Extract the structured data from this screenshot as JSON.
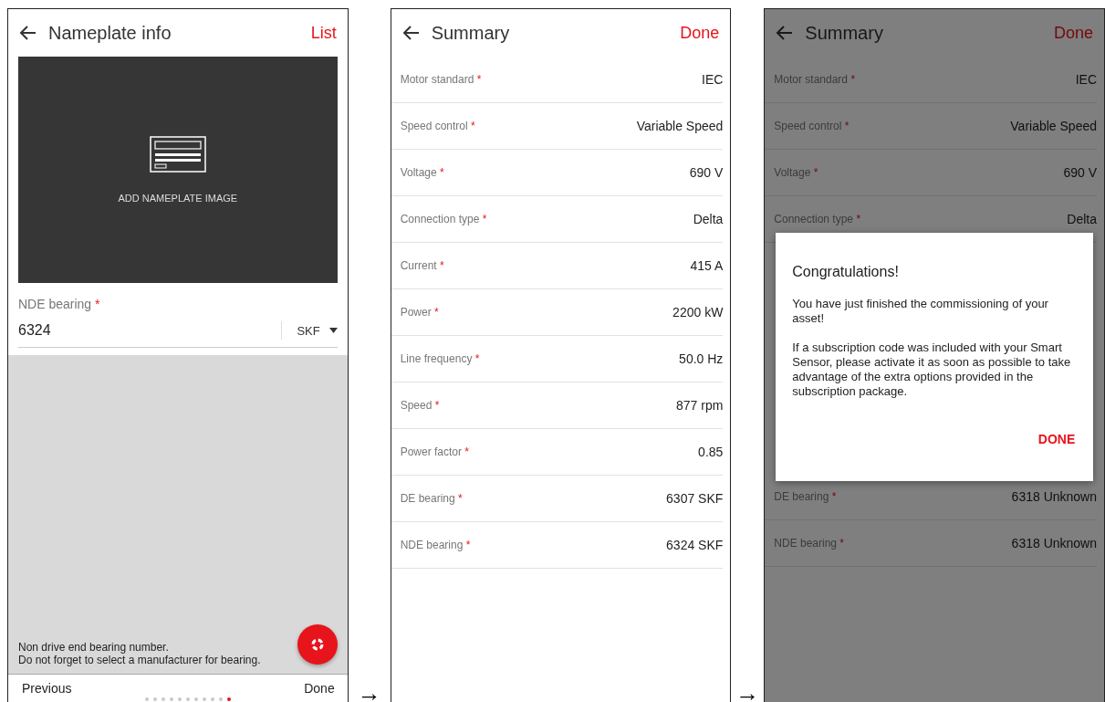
{
  "screens": [
    {
      "kind": "nameplate",
      "title": "Nameplate info",
      "action": "List",
      "image_label": "ADD NAMEPLATE IMAGE",
      "field": {
        "label": "NDE bearing",
        "required_mark": "*",
        "value": "6324",
        "manufacturer": "SKF"
      },
      "hint": [
        "Non drive end bearing number.",
        "Do not forget to select a manufacturer for bearing."
      ],
      "footer": {
        "previous": "Previous",
        "next": "Done",
        "pages": [
          {
            "selected": false
          },
          {
            "selected": false
          },
          {
            "selected": false
          },
          {
            "selected": false
          },
          {
            "selected": false
          },
          {
            "selected": false
          },
          {
            "selected": false
          },
          {
            "selected": false
          },
          {
            "selected": false
          },
          {
            "selected": false
          },
          {
            "selected": true
          }
        ]
      }
    },
    {
      "kind": "arrow",
      "symbol": "→"
    },
    {
      "kind": "summary",
      "title": "Summary",
      "action": "Done",
      "rows": [
        {
          "label": "Motor standard",
          "mark": "*",
          "value": "IEC"
        },
        {
          "label": "Speed control",
          "mark": "*",
          "value": "Variable Speed"
        },
        {
          "label": "Voltage",
          "mark": "*",
          "value": "690 V"
        },
        {
          "label": "Connection type",
          "mark": "*",
          "value": "Delta"
        },
        {
          "label": "Current",
          "mark": "*",
          "value": "415 A"
        },
        {
          "label": "Power",
          "mark": "*",
          "value": "2200 kW"
        },
        {
          "label": "Line frequency",
          "mark": "*",
          "value": "50.0 Hz"
        },
        {
          "label": "Speed",
          "mark": "*",
          "value": "877 rpm"
        },
        {
          "label": "Power factor",
          "mark": "*",
          "value": "0.85"
        },
        {
          "label": "DE bearing",
          "mark": "*",
          "value": "6307 SKF"
        },
        {
          "label": "NDE bearing",
          "mark": "*",
          "value": "6324 SKF"
        }
      ]
    },
    {
      "kind": "arrow",
      "symbol": "→"
    },
    {
      "kind": "summary_dialog",
      "title": "Summary",
      "action": "Done",
      "rows_above": [
        {
          "label": "Motor standard",
          "mark": "*",
          "value": "IEC"
        },
        {
          "label": "Speed control",
          "mark": "*",
          "value": "Variable Speed"
        },
        {
          "label": "Voltage",
          "mark": "*",
          "value": "690 V"
        },
        {
          "label": "Connection type",
          "mark": "*",
          "value": "Delta"
        }
      ],
      "rows_below": [
        {
          "label": "DE bearing",
          "mark": "*",
          "value": "6318 Unknown"
        },
        {
          "label": "NDE bearing",
          "mark": "*",
          "value": "6318 Unknown"
        }
      ],
      "dialog": {
        "title": "Congratulations!",
        "paragraphs": [
          "You have just finished the commissioning of your asset!",
          "If a subscription code was included with your Smart Sensor, please activate it as soon as possible to take advantage of the extra options provided in the subscription package."
        ],
        "button": "DONE"
      }
    }
  ]
}
